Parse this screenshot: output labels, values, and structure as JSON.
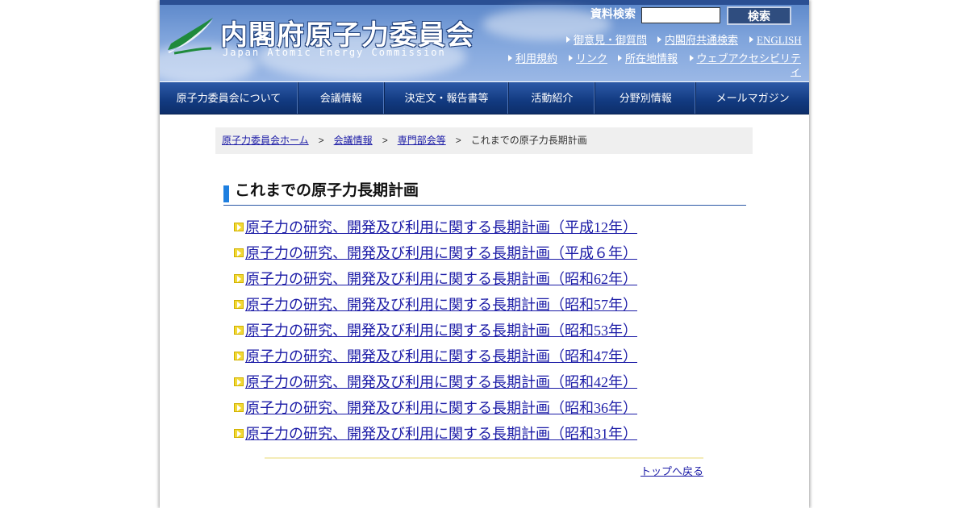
{
  "header": {
    "title": "内閣府原子力委員会",
    "subtitle": "Japan Atomic Energy Commission",
    "search_label": "資料検索",
    "search_input_value": "",
    "search_button": "検索",
    "links": [
      "御意見・御質問",
      "内閣府共通検索",
      "ENGLISH",
      "利用規約",
      "リンク",
      "所在地情報",
      "ウェブアクセシビリティ"
    ]
  },
  "nav": {
    "items": [
      "原子力委員会について",
      "会議情報",
      "決定文・報告書等",
      "活動紹介",
      "分野別情報",
      "メールマガジン"
    ]
  },
  "breadcrumb": {
    "items": [
      "原子力委員会ホーム",
      "会議情報",
      "専門部会等"
    ],
    "separator": ">",
    "current": "これまでの原子力長期計画"
  },
  "main": {
    "heading": "これまでの原子力長期計画",
    "plans": [
      "原子力の研究、開発及び利用に関する長期計画（平成12年）",
      "原子力の研究、開発及び利用に関する長期計画（平成６年）",
      "原子力の研究、開発及び利用に関する長期計画（昭和62年）",
      "原子力の研究、開発及び利用に関する長期計画（昭和57年）",
      "原子力の研究、開発及び利用に関する長期計画（昭和53年）",
      "原子力の研究、開発及び利用に関する長期計画（昭和47年）",
      "原子力の研究、開発及び利用に関する長期計画（昭和42年）",
      "原子力の研究、開発及び利用に関する長期計画（昭和36年）",
      "原子力の研究、開発及び利用に関する長期計画（昭和31年）"
    ],
    "back_to_top": "トップへ戻る"
  },
  "colors": {
    "nav_background": "#123a80",
    "link": "#1a1aa6",
    "heading_bar": "#1e7fe0",
    "bullet": "#f2d935"
  }
}
